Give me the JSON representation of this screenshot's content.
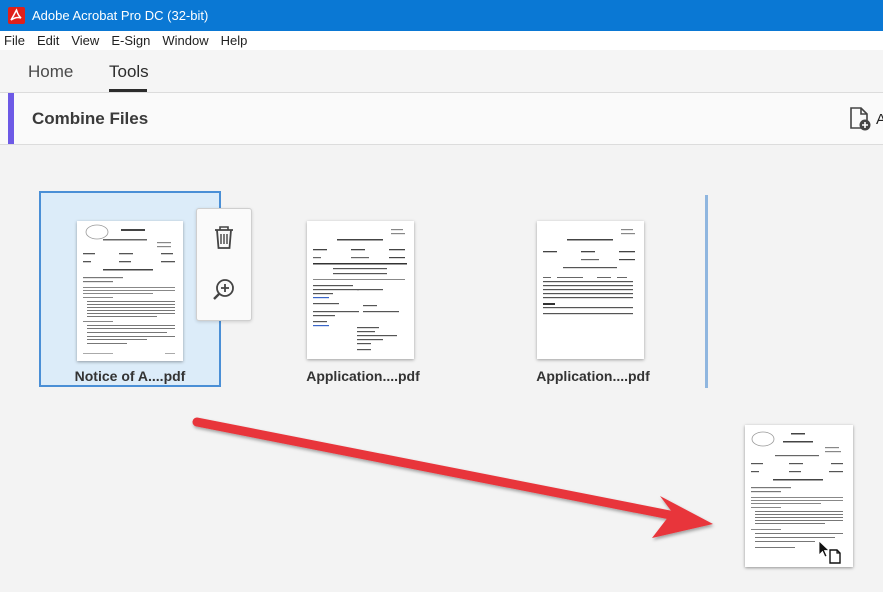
{
  "window": {
    "title": "Adobe Acrobat Pro DC (32-bit)"
  },
  "menu": [
    "File",
    "Edit",
    "View",
    "E-Sign",
    "Window",
    "Help"
  ],
  "tabs": {
    "home": "Home",
    "tools": "Tools"
  },
  "tool_header": {
    "title": "Combine Files",
    "add_files_label": "A"
  },
  "files": [
    {
      "name": "Notice of A....pdf",
      "selected": true
    },
    {
      "name": "Application....pdf",
      "selected": false
    },
    {
      "name": "Application....pdf",
      "selected": false
    }
  ],
  "card_actions": {
    "delete": "trash-icon",
    "zoom": "zoom-in-icon"
  },
  "colors": {
    "titlebar": "#0a78d4",
    "accent": "#6d5ae6",
    "selection": "#4a8fd6",
    "arrow": "#e8353b"
  }
}
